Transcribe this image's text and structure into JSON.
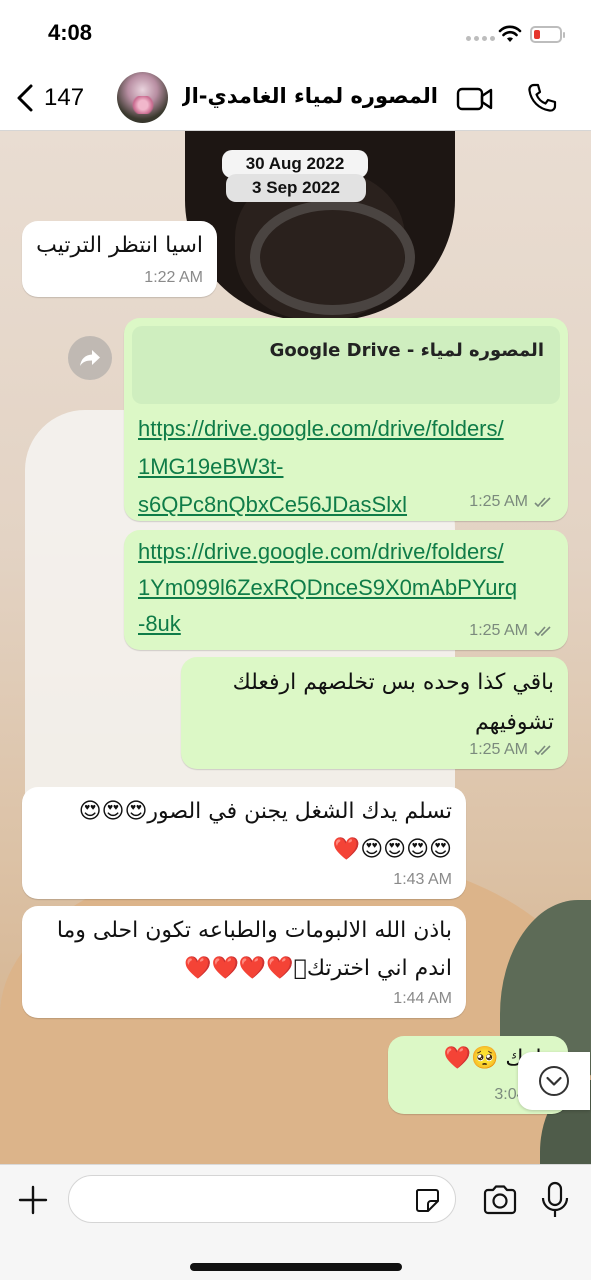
{
  "status_bar": {
    "time": "4:08"
  },
  "header": {
    "back_count": "147",
    "contact_name": "المصوره لمياء الغامدي-ال...",
    "icons": {
      "back": "chevron-left-icon",
      "video": "video-call-icon",
      "phone": "phone-call-icon"
    }
  },
  "dates": [
    "30 Aug 2022",
    "3 Sep 2022"
  ],
  "messages": [
    {
      "dir": "in",
      "text": "اسيا انتظر الترتيب",
      "time": "1:22 AM"
    },
    {
      "dir": "out",
      "preview_title": "المصوره لمياء - Google Drive",
      "link": "https://drive.google.com/drive/folders/1MG19eBW3t-s6QPc8nQbxCe56JDasSlxl",
      "time": "1:25 AM",
      "link_lines": [
        "https://drive.google.com/drive/folders/",
        "1MG19eBW3t-",
        "s6QPc8nQbxCe56JDasSlxl"
      ]
    },
    {
      "dir": "out",
      "link": "https://drive.google.com/drive/folders/1Ym099l6ZexRQDnceS9X0mAbPYurq-8uk",
      "time": "1:25 AM",
      "link_lines": [
        "https://drive.google.com/drive/folders/",
        "1Ym099l6ZexRQDnceS9X0mAbPYurq",
        "-8uk"
      ]
    },
    {
      "dir": "out",
      "text": "باقي كذا وحده بس تخلصهم ارفعلك تشوفيهم",
      "time": "1:25 AM"
    },
    {
      "dir": "in",
      "text_line1": "تسلم يدك الشغل يجنن في الصور😍😍😍",
      "text_line2": "😍😍😍😍❤️",
      "time": "1:43 AM"
    },
    {
      "dir": "in",
      "text_line1": "باذن الله الالبومات والطباعه تكون احلى وما",
      "text_line2": "اندم اني اخترتك🏻❤️❤️❤️❤️",
      "time": "1:44 AM"
    },
    {
      "dir": "out",
      "text": "ملوك 🥺❤️",
      "time": "3:04 PM"
    }
  ],
  "input": {
    "placeholder": ""
  },
  "colors": {
    "outgoing_bubble": "#dcf8c6",
    "incoming_bubble": "#ffffff",
    "link": "#0f7c48"
  }
}
